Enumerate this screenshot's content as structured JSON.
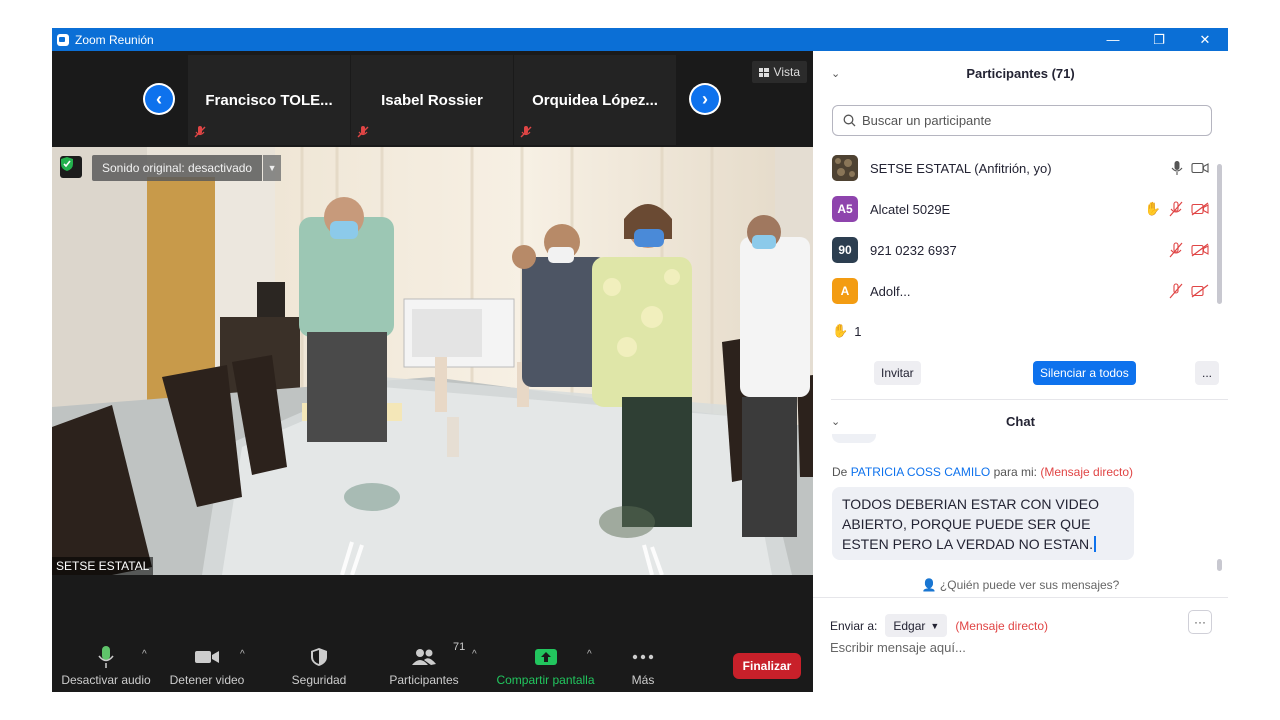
{
  "window": {
    "title": "Zoom Reunión",
    "minimize": "—",
    "restore": "❐",
    "close": "✕"
  },
  "strip": {
    "tiles": [
      {
        "name": "Francisco  TOLE..."
      },
      {
        "name": "Isabel Rossier"
      },
      {
        "name": "Orquidea  López..."
      }
    ],
    "vista": "Vista"
  },
  "video": {
    "sonido_original": "Sonido original: desactivado",
    "speaker": "SETSE ESTATAL"
  },
  "toolbar": {
    "audio": "Desactivar audio",
    "video": "Detener video",
    "security": "Seguridad",
    "participants": "Participantes",
    "participants_count": "71",
    "share": "Compartir pantalla",
    "more": "Más",
    "end": "Finalizar"
  },
  "participants": {
    "header": "Participantes (71)",
    "search_placeholder": "Buscar un participante",
    "list": [
      {
        "name": "SETSE ESTATAL (Anfitrión, yo)",
        "initials": "",
        "color": "#6b5a44"
      },
      {
        "name": "Alcatel 5029E",
        "initials": "A5",
        "color": "#8e44ad"
      },
      {
        "name": "921 0232 6937",
        "initials": "90",
        "color": "#2c3e50"
      },
      {
        "name": "Adolf...",
        "initials": "A",
        "color": "#f39c12"
      }
    ],
    "raised_hands": "1",
    "invite": "Invitar",
    "mute_all": "Silenciar a todos",
    "more": "..."
  },
  "chat": {
    "header": "Chat",
    "from_prefix": "De",
    "sender": "PATRICIA COSS CAMILO",
    "to": "para mi:",
    "direct": "(Mensaje directo)",
    "message": "TODOS DEBERIAN ESTAR CON VIDEO ABIERTO, PORQUE PUEDE SER QUE ESTEN PERO LA VERDAD NO ESTAN.",
    "who_can_see": "¿Quién puede ver sus mensajes?",
    "send_to_label": "Enviar a:",
    "send_to_value": "Edgar",
    "send_to_direct": "(Mensaje directo)",
    "more": "···",
    "compose_placeholder": "Escribir mensaje aquí..."
  },
  "colors": {
    "accent": "#0e72ed",
    "end": "#c8202a",
    "share": "#22c55e",
    "titlebar": "#0b6fd6"
  }
}
